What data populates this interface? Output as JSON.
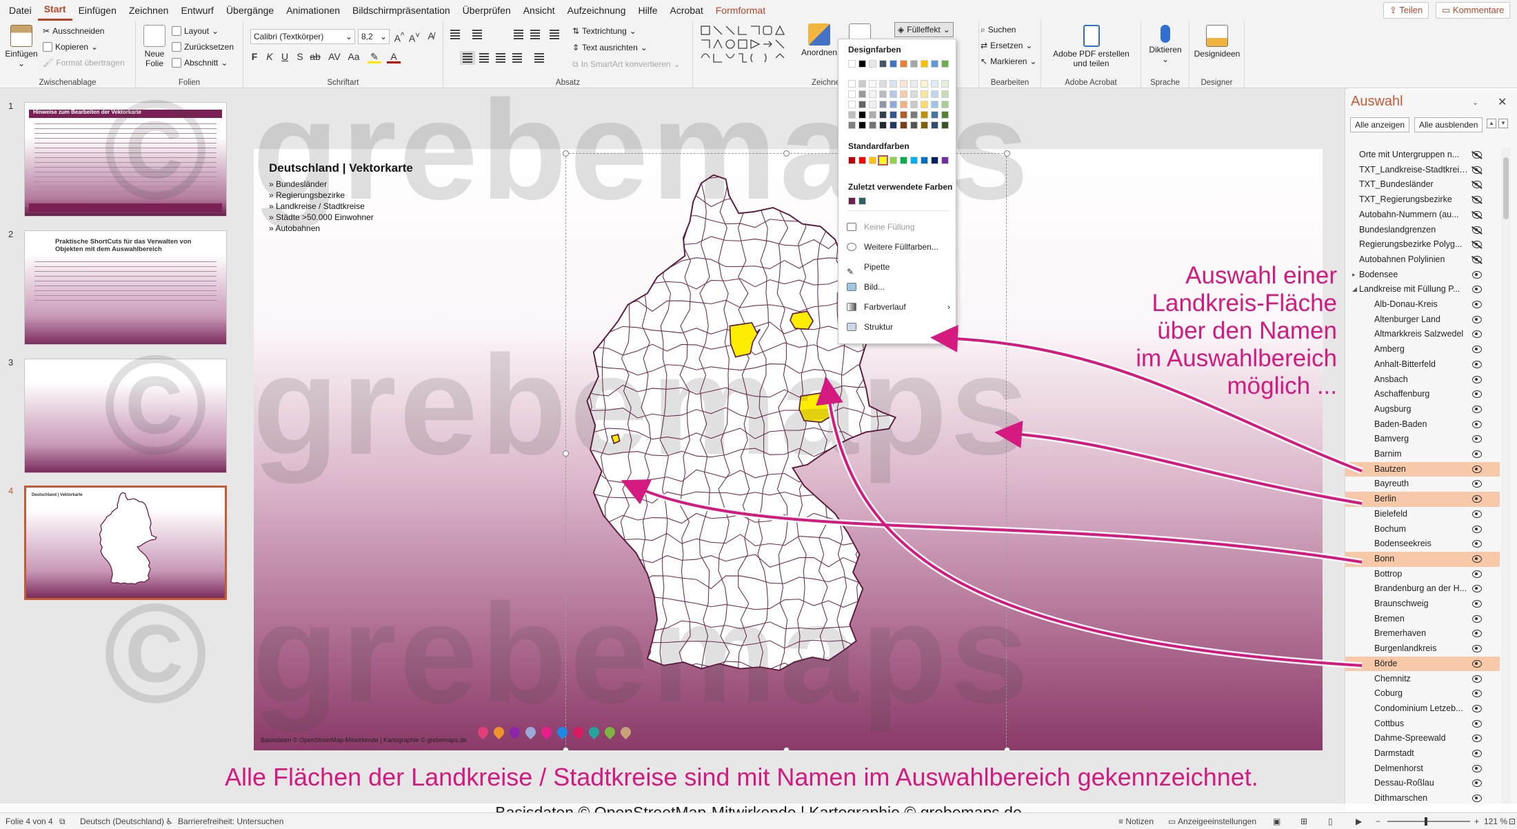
{
  "menu": {
    "tabs": [
      "Datei",
      "Start",
      "Einfügen",
      "Zeichnen",
      "Entwurf",
      "Übergänge",
      "Animationen",
      "Bildschirmpräsentation",
      "Überprüfen",
      "Ansicht",
      "Aufzeichnung",
      "Hilfe",
      "Acrobat",
      "Formformat"
    ],
    "active": "Start",
    "share": "Teilen",
    "comments": "Kommentare"
  },
  "ribbon": {
    "clipboard": {
      "label": "Zwischenablage",
      "paste": "Einfügen",
      "cut": "Ausschneiden",
      "copy": "Kopieren",
      "format": "Format übertragen"
    },
    "slides": {
      "label": "Folien",
      "new_slide": "Neue Folie",
      "layout": "Layout",
      "reset": "Zurücksetzen",
      "section": "Abschnitt"
    },
    "font": {
      "label": "Schriftart",
      "family": "Calibri (Textkörper)",
      "size": "8,2"
    },
    "paragraph": {
      "label": "Absatz",
      "text_direction": "Textrichtung",
      "align_text": "Text ausrichten",
      "smartart": "In SmartArt konvertieren"
    },
    "drawing": {
      "label": "Zeichnen",
      "arrange": "Anordnen",
      "fill_effect": "Fülleffekt"
    },
    "editing": {
      "label": "Bearbeiten",
      "find": "Suchen",
      "replace": "Ersetzen",
      "select": "Markieren"
    },
    "acrobat": {
      "label": "Adobe Acrobat",
      "create_pdf": "Adobe PDF erstellen und teilen"
    },
    "voice": {
      "label": "Sprache",
      "dictate": "Diktieren"
    },
    "designer": {
      "label": "Designer",
      "ideas": "Designideen"
    }
  },
  "fill_dropdown": {
    "design_colors": "Designfarben",
    "standard_colors": "Standardfarben",
    "recent_colors": "Zuletzt verwendete Farben",
    "theme_top": [
      "#ffffff",
      "#000000",
      "#e7e6e6",
      "#44546a",
      "#4472c4",
      "#ed7d31",
      "#a5a5a5",
      "#ffc000",
      "#5b9bd5",
      "#70ad47"
    ],
    "standard": [
      "#c00000",
      "#ff0000",
      "#ffc000",
      "#ffff00",
      "#92d050",
      "#00b050",
      "#00b0f0",
      "#0070c0",
      "#002060",
      "#7030a0"
    ],
    "recent": [
      "#6e1f4f",
      "#2f5f67"
    ],
    "no_fill": "Keine Füllung",
    "more_colors": "Weitere Füllfarben...",
    "eyedropper": "Pipette",
    "picture": "Bild...",
    "gradient": "Farbverlauf",
    "texture": "Struktur"
  },
  "thumbnails": [
    {
      "num": "1",
      "title": "Hinweise zum Bearbeiten der Vektorkarte"
    },
    {
      "num": "2",
      "title": "Praktische ShortCuts für das Verwalten von Objekten mit dem Auswahlbereich"
    },
    {
      "num": "3",
      "title": ""
    },
    {
      "num": "4",
      "title": "Deutschland | Vektorkarte"
    }
  ],
  "slide": {
    "title": "Deutschland | Vektorkarte",
    "bullets": [
      "» Bundesländer",
      "» Regierungsbezirke",
      "» Landkreise / Stadtkreise",
      "» Städte >50.000 Einwohner",
      "» Autobahnen"
    ],
    "credit": "Basisdaten © OpenStreetMap-Mitwirkende | Kartographie © grebemaps.de",
    "pin_colors": [
      "#e0407b",
      "#f0932b",
      "#8e24aa",
      "#9fa8da",
      "#e91e8c",
      "#1e88e5",
      "#d81b60",
      "#26a69a",
      "#7cb342",
      "#c7a27a"
    ],
    "highlight_color": "#ffed00"
  },
  "watermark": "© grebemaps",
  "annotations": {
    "right": [
      "Auswahl einer",
      "Landkreis-Fläche",
      "über den Namen",
      "im Auswahlbereich",
      "möglich ..."
    ],
    "bottom": "Alle Flächen der Landkreise / Stadtkreise sind mit Namen im Auswahlbereich gekennzeichnet.",
    "footer": "Basisdaten © OpenStreetMap-Mitwirkende | Kartographie © grebemaps.de",
    "color": "#d41a7f"
  },
  "selection_pane": {
    "title": "Auswahl",
    "show_all": "Alle anzeigen",
    "hide_all": "Alle ausblenden",
    "items": [
      {
        "name": "Orte mit Untergruppen n...",
        "level": 0,
        "visible": false,
        "hl": false
      },
      {
        "name": "TXT_Landkreise-Stadtkreise",
        "level": 0,
        "visible": false,
        "hl": false
      },
      {
        "name": "TXT_Bundesländer",
        "level": 0,
        "visible": false,
        "hl": false
      },
      {
        "name": "TXT_Regierungsbezirke",
        "level": 0,
        "visible": false,
        "hl": false
      },
      {
        "name": "Autobahn-Nummern (au...",
        "level": 0,
        "visible": false,
        "hl": false
      },
      {
        "name": "Bundeslandgrenzen",
        "level": 0,
        "visible": false,
        "hl": false
      },
      {
        "name": "Regierungsbezirke Polyg...",
        "level": 0,
        "visible": false,
        "hl": false
      },
      {
        "name": "Autobahnen Polylinien",
        "level": 0,
        "visible": false,
        "hl": false
      },
      {
        "name": "Bodensee",
        "level": 0,
        "visible": true,
        "hl": false
      },
      {
        "name": "Landkreise mit Füllung P...",
        "level": 0,
        "visible": true,
        "hl": false
      },
      {
        "name": "Alb-Donau-Kreis",
        "level": 1,
        "visible": true,
        "hl": false
      },
      {
        "name": "Altenburger Land",
        "level": 1,
        "visible": true,
        "hl": false
      },
      {
        "name": "Altmarkkreis Salzwedel",
        "level": 1,
        "visible": true,
        "hl": false
      },
      {
        "name": "Amberg",
        "level": 1,
        "visible": true,
        "hl": false
      },
      {
        "name": "Anhalt-Bitterfeld",
        "level": 1,
        "visible": true,
        "hl": false
      },
      {
        "name": "Ansbach",
        "level": 1,
        "visible": true,
        "hl": false
      },
      {
        "name": "Aschaffenburg",
        "level": 1,
        "visible": true,
        "hl": false
      },
      {
        "name": "Augsburg",
        "level": 1,
        "visible": true,
        "hl": false
      },
      {
        "name": "Baden-Baden",
        "level": 1,
        "visible": true,
        "hl": false
      },
      {
        "name": "Bamverg",
        "level": 1,
        "visible": true,
        "hl": false
      },
      {
        "name": "Barnim",
        "level": 1,
        "visible": true,
        "hl": false
      },
      {
        "name": "Bautzen",
        "level": 1,
        "visible": true,
        "hl": true
      },
      {
        "name": "Bayreuth",
        "level": 1,
        "visible": true,
        "hl": false
      },
      {
        "name": "Berlin",
        "level": 1,
        "visible": true,
        "hl": true
      },
      {
        "name": "Bielefeld",
        "level": 1,
        "visible": true,
        "hl": false
      },
      {
        "name": "Bochum",
        "level": 1,
        "visible": true,
        "hl": false
      },
      {
        "name": "Bodenseekreis",
        "level": 1,
        "visible": true,
        "hl": false
      },
      {
        "name": "Bonn",
        "level": 1,
        "visible": true,
        "hl": true
      },
      {
        "name": "Bottrop",
        "level": 1,
        "visible": true,
        "hl": false
      },
      {
        "name": "Brandenburg an der H...",
        "level": 1,
        "visible": true,
        "hl": false
      },
      {
        "name": "Braunschweig",
        "level": 1,
        "visible": true,
        "hl": false
      },
      {
        "name": "Bremen",
        "level": 1,
        "visible": true,
        "hl": false
      },
      {
        "name": "Bremerhaven",
        "level": 1,
        "visible": true,
        "hl": false
      },
      {
        "name": "Burgenlandkreis",
        "level": 1,
        "visible": true,
        "hl": false
      },
      {
        "name": "Börde",
        "level": 1,
        "visible": true,
        "hl": true
      },
      {
        "name": "Chemnitz",
        "level": 1,
        "visible": true,
        "hl": false
      },
      {
        "name": "Coburg",
        "level": 1,
        "visible": true,
        "hl": false
      },
      {
        "name": "Condominium Letzeb...",
        "level": 1,
        "visible": true,
        "hl": false
      },
      {
        "name": "Cottbus",
        "level": 1,
        "visible": true,
        "hl": false
      },
      {
        "name": "Dahme-Spreewald",
        "level": 1,
        "visible": true,
        "hl": false
      },
      {
        "name": "Darmstadt",
        "level": 1,
        "visible": true,
        "hl": false
      },
      {
        "name": "Delmenhorst",
        "level": 1,
        "visible": true,
        "hl": false
      },
      {
        "name": "Dessau-Roßlau",
        "level": 1,
        "visible": true,
        "hl": false
      },
      {
        "name": "Dithmarschen",
        "level": 1,
        "visible": true,
        "hl": false
      }
    ]
  },
  "status": {
    "slide_info": "Folie 4 von 4",
    "language": "Deutsch (Deutschland)",
    "accessibility": "Barrierefreiheit: Untersuchen",
    "notes": "Notizen",
    "display_settings": "Anzeigeeinstellungen",
    "zoom": "121 %"
  }
}
